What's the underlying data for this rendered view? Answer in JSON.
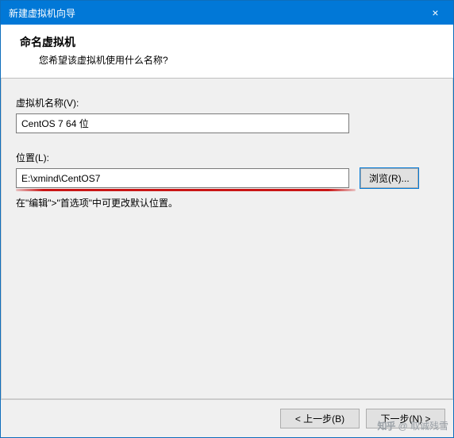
{
  "titlebar": {
    "title": "新建虚拟机向导",
    "close_icon": "×"
  },
  "header": {
    "title": "命名虚拟机",
    "subtitle": "您希望该虚拟机使用什么名称?"
  },
  "fields": {
    "name": {
      "label": "虚拟机名称(V):",
      "value": "CentOS 7 64 位"
    },
    "location": {
      "label": "位置(L):",
      "value": "E:\\xmind\\CentOS7",
      "browse_label": "浏览(R)..."
    }
  },
  "hint": "在\"编辑\">\"首选项\"中可更改默认位置。",
  "buttons": {
    "back": "< 上一步(B)",
    "next": "下一步(N) >"
  },
  "watermark": {
    "logo": "知乎",
    "user": "@ 取诚残雪"
  }
}
